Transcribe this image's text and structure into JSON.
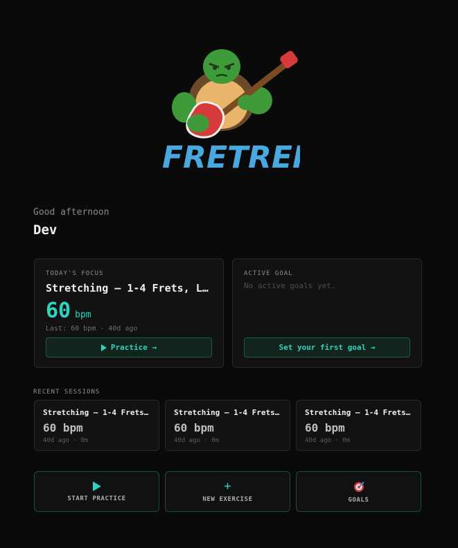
{
  "brand": {
    "logo_text": "FRETREP"
  },
  "greeting": {
    "text": "Good afternoon",
    "name": "Dev"
  },
  "focus": {
    "label": "TODAY'S FOCUS",
    "title": "Stretching — 1-4 Frets, L…",
    "bpm": "60",
    "bpm_unit": "bpm",
    "last": "Last: 60 bpm · 40d ago",
    "practice_button": "Practice →"
  },
  "goal": {
    "label": "ACTIVE GOAL",
    "empty": "No active goals yet.",
    "set_goal_button": "Set your first goal →"
  },
  "recent": {
    "label": "RECENT SESSIONS",
    "sessions": [
      {
        "title": "Stretching — 1-4 Frets…",
        "bpm": "60 bpm",
        "meta": "40d ago · 0m"
      },
      {
        "title": "Stretching — 1-4 Frets…",
        "bpm": "60 bpm",
        "meta": "40d ago · 0m"
      },
      {
        "title": "Stretching — 1-4 Frets…",
        "bpm": "60 bpm",
        "meta": "40d ago · 0m"
      }
    ]
  },
  "actions": [
    {
      "label": "START PRACTICE",
      "icon": "play-icon"
    },
    {
      "label": "NEW EXERCISE",
      "icon": "plus-icon",
      "glyph": "+"
    },
    {
      "label": "GOALS",
      "icon": "target-icon"
    }
  ],
  "colors": {
    "accent": "#2dd4bf",
    "background": "#0a0a0a",
    "card": "#121212"
  }
}
